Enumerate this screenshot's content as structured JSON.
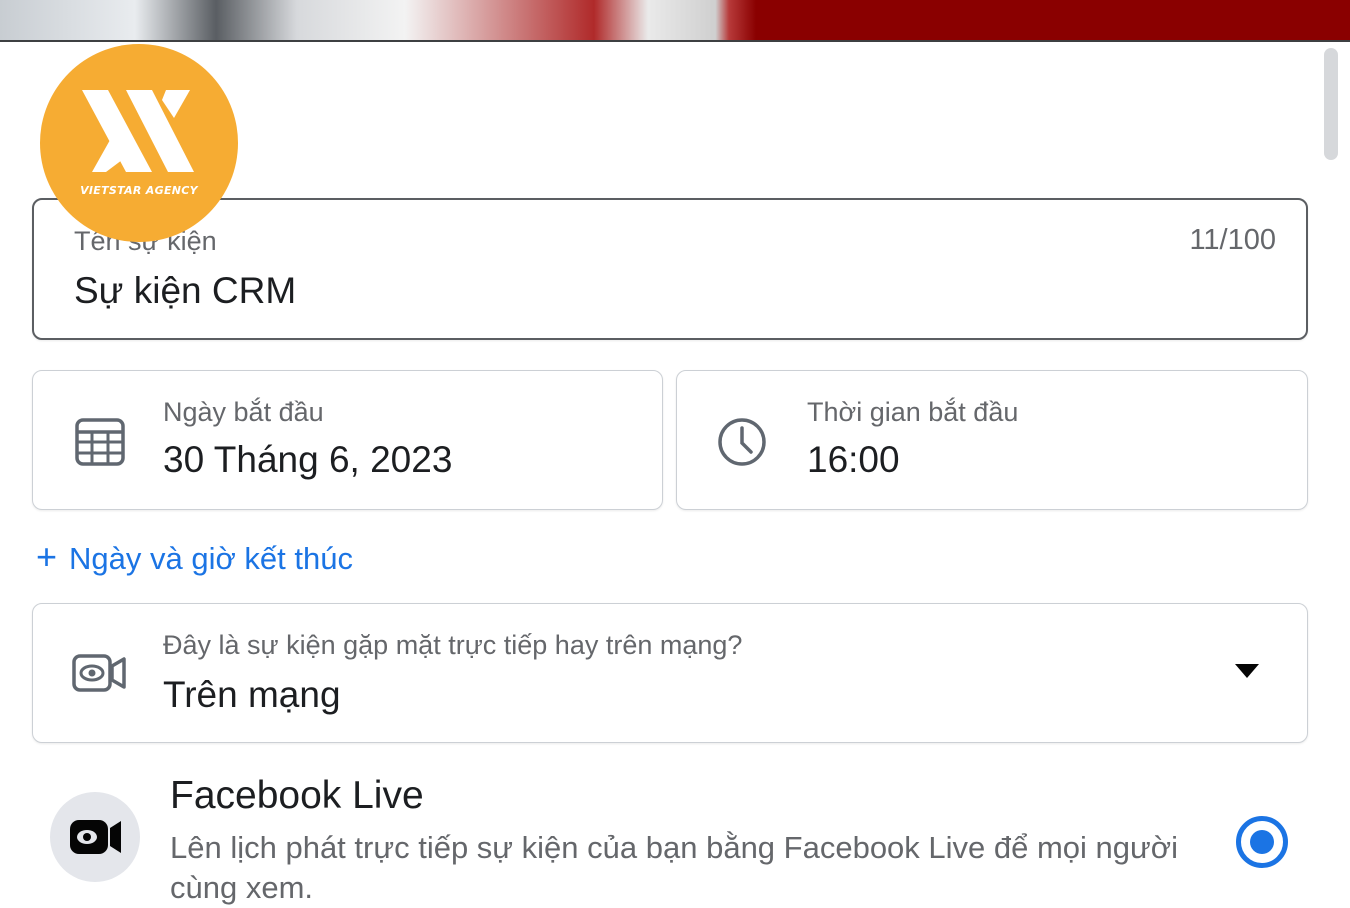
{
  "logo": {
    "text": "VIETSTAR AGENCY",
    "color": "#f6ac33"
  },
  "event_name": {
    "label": "Tên sự kiện",
    "value": "Sự kiện CRM",
    "counter": "11/100"
  },
  "start_date": {
    "label": "Ngày bắt đầu",
    "value": "30 Tháng 6, 2023",
    "icon": "calendar-icon"
  },
  "start_time": {
    "label": "Thời gian bắt đầu",
    "value": "16:00",
    "icon": "clock-icon"
  },
  "add_end": {
    "plus": "+",
    "label": "Ngày và giờ kết thúc",
    "color": "#1b74e4"
  },
  "location_type": {
    "label": "Đây là sự kiện gặp mặt trực tiếp hay trên mạng?",
    "value": "Trên mạng",
    "icon": "video-camera-icon"
  },
  "live_option": {
    "title": "Facebook Live",
    "description": "Lên lịch phát trực tiếp sự kiện của bạn bằng Facebook Live để mọi người cùng xem.",
    "selected": true,
    "icon": "live-video-icon"
  },
  "accent_color": "#1b74e4"
}
